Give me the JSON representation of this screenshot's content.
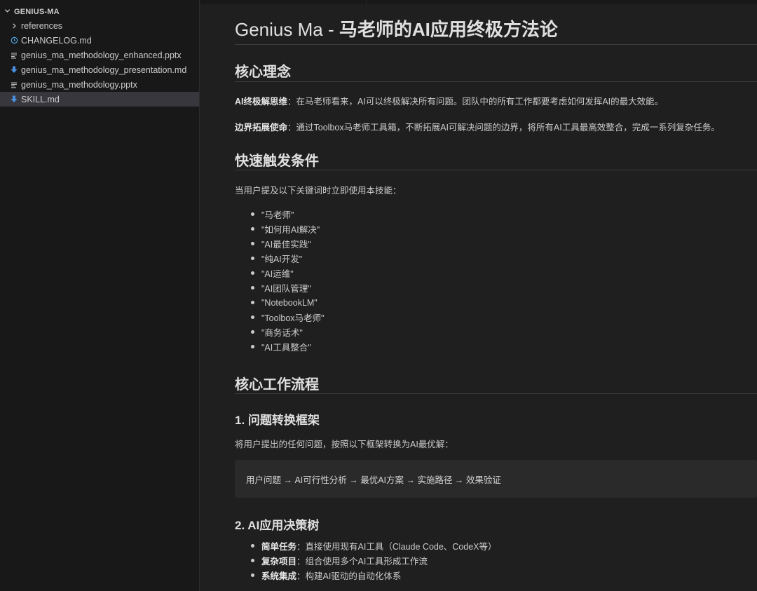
{
  "explorer": {
    "folder_name": "GENIUS-MA",
    "items": [
      {
        "label": "references",
        "icon": "chevron-right-icon",
        "kind": "folder"
      },
      {
        "label": "CHANGELOG.md",
        "icon": "info-icon",
        "kind": "file"
      },
      {
        "label": "genius_ma_methodology_enhanced.pptx",
        "icon": "lines-icon",
        "kind": "file"
      },
      {
        "label": "genius_ma_methodology_presentation.md",
        "icon": "download-arrow-icon",
        "kind": "file"
      },
      {
        "label": "genius_ma_methodology.pptx",
        "icon": "lines-icon",
        "kind": "file"
      },
      {
        "label": "SKILL.md",
        "icon": "download-arrow-icon",
        "kind": "file",
        "selected": true
      }
    ]
  },
  "doc": {
    "title_prefix": "Genius Ma - ",
    "title_rest": "马老师的AI应用终极方法论",
    "sec1_heading": "核心理念",
    "quote1_bold": "AI终极解思维",
    "quote1_text": "：在马老师看来，AI可以终极解决所有问题。团队中的所有工作都要考虑如何发挥AI的最大效能。",
    "para2_bold": "边界拓展使命",
    "para2_text": "：通过Toolbox马老师工具箱，不断拓展AI可解决问题的边界，将所有AI工具最高效整合，完成一系列复杂任务。",
    "sec2_heading": "快速触发条件",
    "sec2_intro": "当用户提及以下关键词时立即使用本技能：",
    "keywords": [
      "\"马老师\"",
      "\"如何用AI解决\"",
      "\"AI最佳实践\"",
      "\"纯AI开发\"",
      "\"AI运维\"",
      "\"AI团队管理\"",
      "\"NotebookLM\"",
      "\"Toolbox马老师\"",
      "\"商务话术\"",
      "\"AI工具整合\""
    ],
    "sec3_heading": "核心工作流程",
    "sub1_heading": "1. 问题转换框架",
    "sub1_intro": "将用户提出的任何问题，按照以下框架转换为AI最优解：",
    "code_line": "用户问题 → AI可行性分析 → 最优AI方案 → 实施路径 → 效果验证",
    "sub2_heading": "2. AI应用决策树",
    "decisions": [
      {
        "bold": "简单任务",
        "text": "：直接使用现有AI工具（Claude Code、CodeX等）"
      },
      {
        "bold": "复杂项目",
        "text": "：组合使用多个AI工具形成工作流"
      },
      {
        "bold": "系统集成",
        "text": "：构建AI驱动的自动化体系"
      }
    ]
  }
}
